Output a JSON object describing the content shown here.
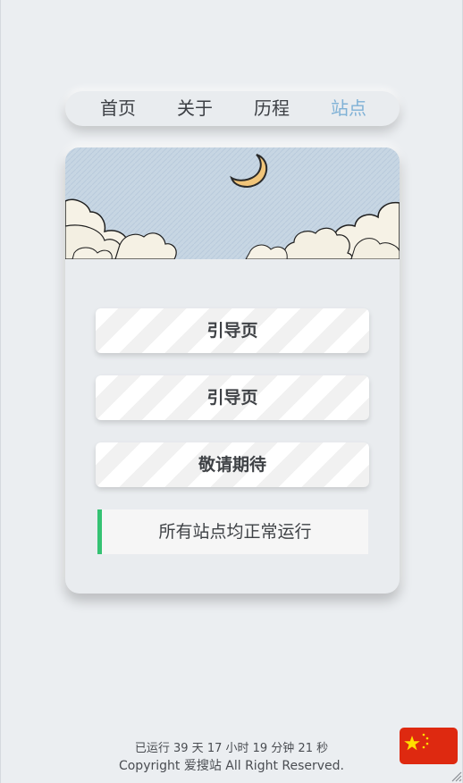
{
  "nav": {
    "items": [
      {
        "label": "首页",
        "active": false
      },
      {
        "label": "关于",
        "active": false
      },
      {
        "label": "历程",
        "active": false
      },
      {
        "label": "站点",
        "active": true
      }
    ]
  },
  "card": {
    "buttons": [
      {
        "label": "引导页"
      },
      {
        "label": "引导页"
      },
      {
        "label": "敬请期待"
      }
    ],
    "status": {
      "text": "所有站点均正常运行",
      "accent_color": "#35c273"
    }
  },
  "footer": {
    "runtime": "已运行 39 天 17 小时 19 分钟 21 秒",
    "copyright": "Copyright 爱搜站 All Right Reserved."
  },
  "icons": {
    "banner": "moon-clouds-illustration",
    "flag": "china-flag-icon"
  },
  "colors": {
    "background": "#ebeef1",
    "nav_active": "#7fb1d6",
    "flag_red": "#de2910",
    "flag_star": "#ffde00"
  }
}
